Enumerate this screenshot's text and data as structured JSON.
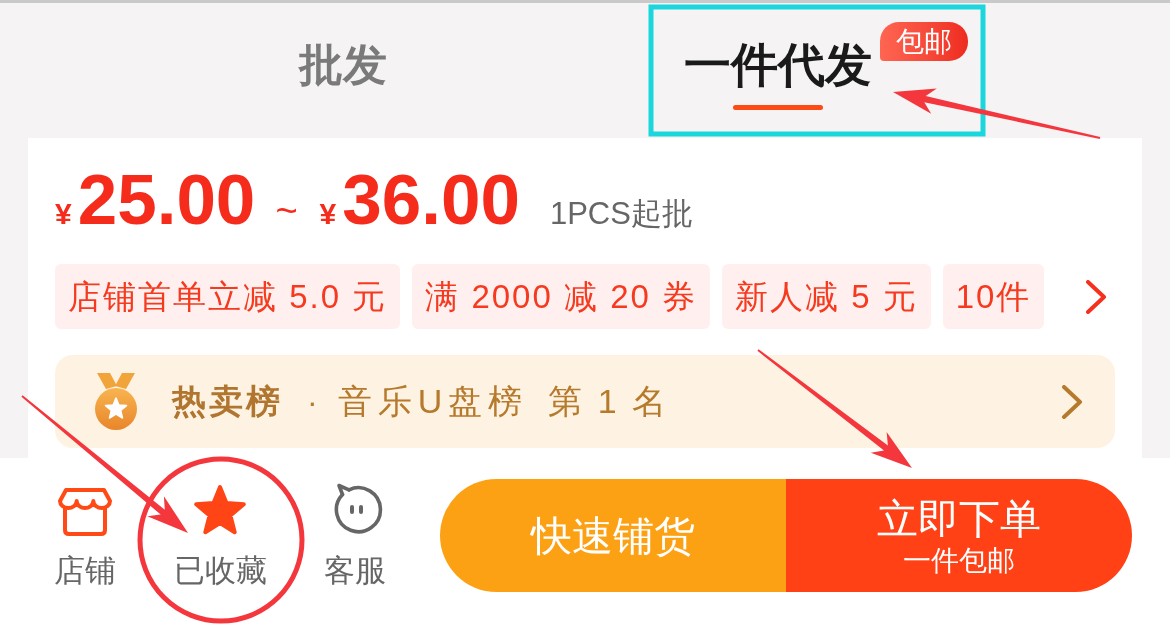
{
  "tabs": [
    {
      "label": "批发",
      "selected": false
    },
    {
      "label": "一件代发",
      "selected": true,
      "badge": "包邮"
    }
  ],
  "price": {
    "currency_low": "¥",
    "low": "25.00",
    "separator": "~",
    "currency_high": "¥",
    "high": "36.00",
    "min_order": "1PCS起批"
  },
  "coupons": [
    "店铺首单立减 5.0 元",
    "满 2000 减 20 券",
    "新人减 5 元",
    "10件"
  ],
  "ranking": {
    "title": "热卖榜",
    "separator": "·",
    "list": "音乐U盘榜",
    "rank": "第 1 名"
  },
  "bottom_bar": {
    "actions": [
      {
        "kind": "store",
        "label": "店铺"
      },
      {
        "kind": "favorite",
        "label": "已收藏",
        "checked": true
      },
      {
        "kind": "service",
        "label": "客服"
      }
    ],
    "buttons": [
      {
        "kind": "secondary",
        "label": "快速铺货"
      },
      {
        "kind": "primary",
        "label": "立即下单",
        "sublabel": "一件包邮"
      }
    ]
  },
  "annotations": [
    {
      "kind": "frame"
    },
    {
      "kind": "arrow"
    },
    {
      "kind": "arrow"
    },
    {
      "kind": "arrow"
    },
    {
      "kind": "circle"
    }
  ]
}
